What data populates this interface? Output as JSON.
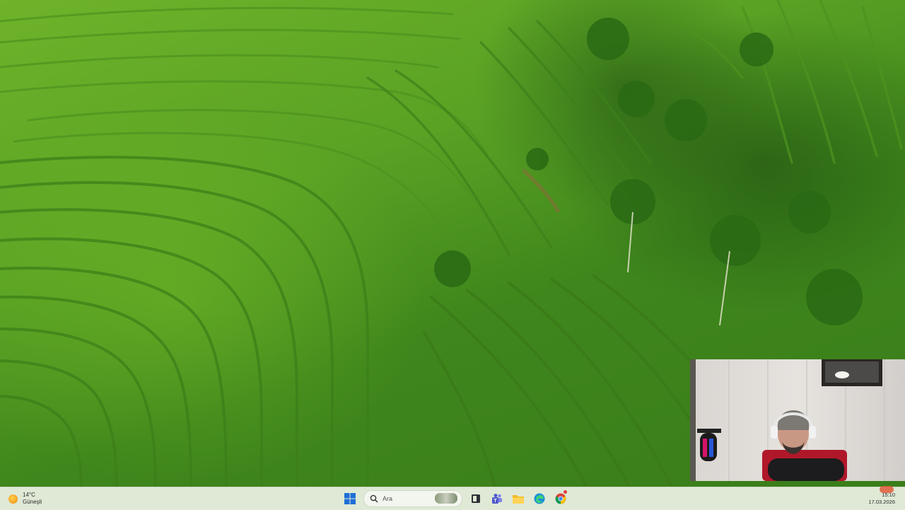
{
  "taskbar": {
    "weather": {
      "temperature": "14°C",
      "condition": "Güneşli"
    },
    "search": {
      "placeholder": "Ara"
    },
    "apps": [
      "start-icon",
      "search-icon",
      "task-view-icon",
      "teams-icon",
      "file-explorer-icon",
      "edge-icon",
      "chrome-icon"
    ],
    "clock": {
      "time": "15:10",
      "date": "17.03.2026"
    }
  },
  "colors": {
    "taskbar_bg": "#dfe9d6",
    "accent_blue": "#1f6fd6",
    "folder_yellow": "#f2b81f"
  }
}
